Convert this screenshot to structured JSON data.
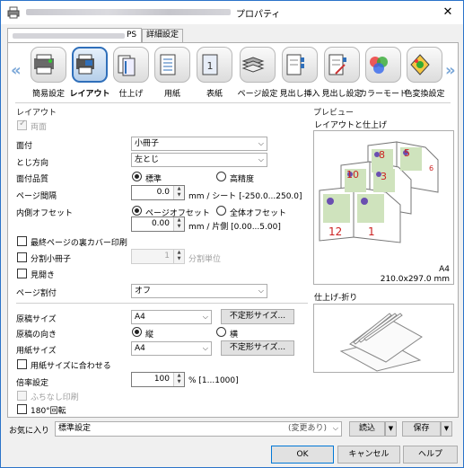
{
  "window": {
    "title": "プロパティ",
    "close_glyph": "✕",
    "tabs": [
      {
        "label": "PS"
      },
      {
        "label": "詳細設定"
      }
    ]
  },
  "iconbar": {
    "prev_glyph": "«",
    "next_glyph": "»",
    "items": [
      {
        "label": "簡易設定",
        "icon": "quick-setting-icon"
      },
      {
        "label": "レイアウト",
        "icon": "layout-icon",
        "selected": true
      },
      {
        "label": "仕上げ",
        "icon": "finishing-icon"
      },
      {
        "label": "用紙",
        "icon": "paper-icon"
      },
      {
        "label": "表紙",
        "icon": "cover-icon"
      },
      {
        "label": "ページ設定",
        "icon": "page-setting-icon"
      },
      {
        "label": "見出し挿入",
        "icon": "tab-insert-icon"
      },
      {
        "label": "見出し設定",
        "icon": "tab-setting-icon"
      },
      {
        "label": "カラーモード",
        "icon": "color-mode-icon"
      },
      {
        "label": "色変換設定",
        "icon": "color-convert-icon"
      }
    ]
  },
  "layout": {
    "section_title": "レイアウト",
    "duplex_label": "両面",
    "print_type_label": "面付",
    "print_type_value": "小冊子",
    "binding_label": "とじ方向",
    "binding_value": "左とじ",
    "quality_label": "面付品質",
    "quality_standard": "標準",
    "quality_high": "高精度",
    "page_gap_label": "ページ間隔",
    "page_gap_value": "0.0",
    "page_gap_unit": "mm / シート [-250.0...250.0]",
    "inner_offset_label": "内側オフセット",
    "offset_page": "ページオフセット",
    "offset_all": "全体オフセット",
    "offset_value": "0.00",
    "offset_unit": "mm / 片側 [0.00...5.00]",
    "last_page_back_label": "最終ページの裏カバー印刷",
    "split_booklet_label": "分割小冊子",
    "split_value": "1",
    "split_unit": "分割単位",
    "spread_label": "見開き",
    "page_layout_label": "ページ割付",
    "page_layout_value": "オフ",
    "original_size_label": "原稿サイズ",
    "original_size_value": "A4",
    "custom_size_button": "不定形サイズ...",
    "orientation_label": "原稿の向き",
    "orientation_portrait": "縦",
    "orientation_landscape": "横",
    "paper_size_label": "用紙サイズ",
    "paper_size_value": "A4",
    "custom_size_button2": "不定形サイズ...",
    "fit_paper_label": "用紙サイズに合わせる",
    "zoom_label": "倍率設定",
    "zoom_value": "100",
    "zoom_unit": "% [1...1000]",
    "borderless_label": "ふちなし印刷",
    "rotate_label": "180°回転"
  },
  "preview": {
    "section_title": "プレビュー",
    "layout_title": "レイアウトと仕上げ",
    "page_numbers": [
      "8",
      "5",
      "6",
      "10",
      "3",
      "12",
      "1"
    ],
    "paper_label": "A4",
    "paper_dims": "210.0x297.0 mm",
    "fold_title": "仕上げ-折り"
  },
  "bottom": {
    "favorite_label": "お気に入り",
    "favorite_value": "標準設定",
    "favorite_status": "(変更あり)",
    "load_button": "読込",
    "save_button": "保存",
    "ok_button": "OK",
    "cancel_button": "キャンセル",
    "help_button": "ヘルプ"
  },
  "colors": {
    "accent": "#2f6fba",
    "number_red": "#cc2222",
    "pane_bg": "#f0f0f0"
  }
}
